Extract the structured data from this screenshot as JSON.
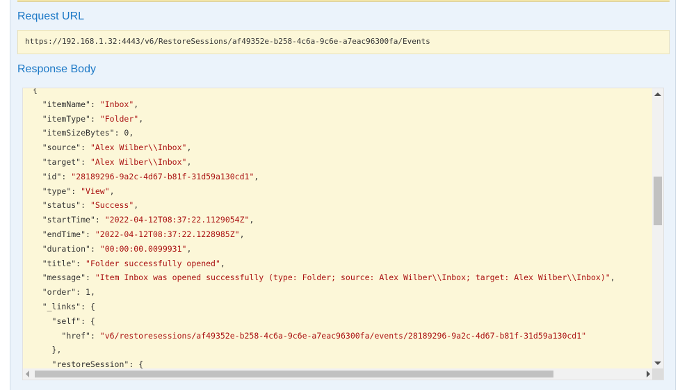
{
  "request_url": {
    "heading": "Request URL",
    "value": "https://192.168.1.32:4443/v6/RestoreSessions/af49352e-b258-4c6a-9c6e-a7eac96300fa/Events"
  },
  "response_body": {
    "heading": "Response Body",
    "lines": [
      {
        "indent": "  ",
        "key": "",
        "value": "",
        "tail": "{"
      },
      {
        "indent": "    ",
        "key": "\"itemName\"",
        "value": "\"Inbox\"",
        "tail": ","
      },
      {
        "indent": "    ",
        "key": "\"itemType\"",
        "value": "\"Folder\"",
        "tail": ","
      },
      {
        "indent": "    ",
        "key": "\"itemSizeBytes\"",
        "value": "0",
        "tail": ","
      },
      {
        "indent": "    ",
        "key": "\"source\"",
        "value": "\"Alex Wilber\\\\Inbox\"",
        "tail": ","
      },
      {
        "indent": "    ",
        "key": "\"target\"",
        "value": "\"Alex Wilber\\\\Inbox\"",
        "tail": ","
      },
      {
        "indent": "    ",
        "key": "\"id\"",
        "value": "\"28189296-9a2c-4d67-b81f-31d59a130cd1\"",
        "tail": ","
      },
      {
        "indent": "    ",
        "key": "\"type\"",
        "value": "\"View\"",
        "tail": ","
      },
      {
        "indent": "    ",
        "key": "\"status\"",
        "value": "\"Success\"",
        "tail": ","
      },
      {
        "indent": "    ",
        "key": "\"startTime\"",
        "value": "\"2022-04-12T08:37:22.1129054Z\"",
        "tail": ","
      },
      {
        "indent": "    ",
        "key": "\"endTime\"",
        "value": "\"2022-04-12T08:37:22.1228985Z\"",
        "tail": ","
      },
      {
        "indent": "    ",
        "key": "\"duration\"",
        "value": "\"00:00:00.0099931\"",
        "tail": ","
      },
      {
        "indent": "    ",
        "key": "\"title\"",
        "value": "\"Folder successfully opened\"",
        "tail": ","
      },
      {
        "indent": "    ",
        "key": "\"message\"",
        "value": "\"Item Inbox was opened successfully (type: Folder; source: Alex Wilber\\\\Inbox; target: Alex Wilber\\\\Inbox)\"",
        "tail": ","
      },
      {
        "indent": "    ",
        "key": "\"order\"",
        "value": "1",
        "tail": ","
      },
      {
        "indent": "    ",
        "key": "\"_links\"",
        "value": "",
        "tail": "{"
      },
      {
        "indent": "      ",
        "key": "\"self\"",
        "value": "",
        "tail": "{"
      },
      {
        "indent": "        ",
        "key": "\"href\"",
        "value": "\"v6/restoresessions/af49352e-b258-4c6a-9c6e-a7eac96300fa/events/28189296-9a2c-4d67-b81f-31d59a130cd1\"",
        "tail": ""
      },
      {
        "indent": "      ",
        "key": "",
        "value": "",
        "tail": "},"
      },
      {
        "indent": "      ",
        "key": "\"restoreSession\"",
        "value": "",
        "tail": "{"
      }
    ]
  },
  "scroll": {
    "vertical_position_fraction": 0.32,
    "horizontal_position_fraction": 0.0
  },
  "colors": {
    "heading": "#1b78c6",
    "code_background": "#fcf7d8",
    "string_value": "#aa1111",
    "panel_background": "#ebf3fb"
  }
}
